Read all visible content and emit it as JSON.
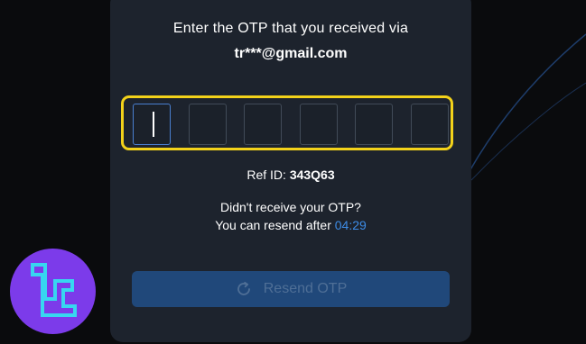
{
  "otp": {
    "prompt": "Enter the OTP that you received via",
    "email": "tr***@gmail.com",
    "digits": [
      "",
      "",
      "",
      "",
      "",
      ""
    ]
  },
  "ref": {
    "label": "Ref ID:",
    "value": "343Q63"
  },
  "resend": {
    "question": "Didn't receive your OTP?",
    "after_text": "You can resend after",
    "timer": "04:29",
    "button_label": "Resend OTP",
    "button_icon": "refresh-icon"
  },
  "colors": {
    "accent": "#3d8ce6",
    "highlight": "#f3d21a",
    "logo_bg": "#7c3bea",
    "card_bg": "#1d232d"
  }
}
